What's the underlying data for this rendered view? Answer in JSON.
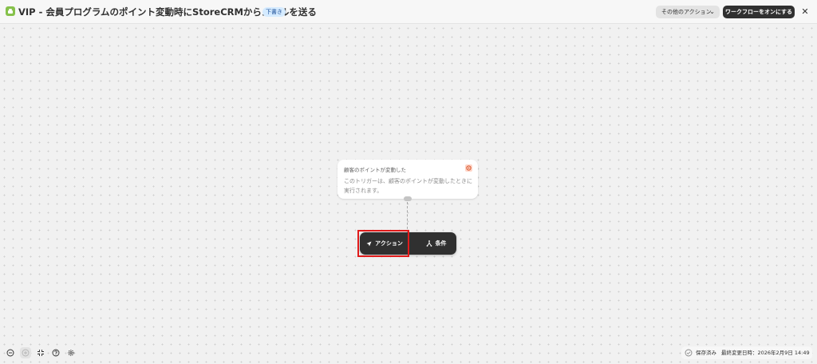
{
  "header": {
    "title": "VIP - 会員プログラムのポイント変動時にStoreCRMからメールを送る",
    "status_badge": "下書き",
    "more_actions_label": "その他のアクション",
    "turn_on_label": "ワークフローをオンにする",
    "app_icon": "app-tile-icon"
  },
  "trigger": {
    "title": "顧客のポイントが変動した",
    "description": "このトリガーは、顧客のポイントが変動したときに実行されます。",
    "icon": "points-icon"
  },
  "add_step": {
    "action_label": "アクション",
    "condition_label": "条件"
  },
  "status": {
    "saved_label": "保存済み",
    "last_updated": "最終変更日時：2026年2月9日 14:49"
  },
  "colors": {
    "canvas": "#f1f1f1",
    "dark_button": "#303030",
    "badge_bg": "#d5ebff",
    "highlight": "#e01b1b"
  }
}
